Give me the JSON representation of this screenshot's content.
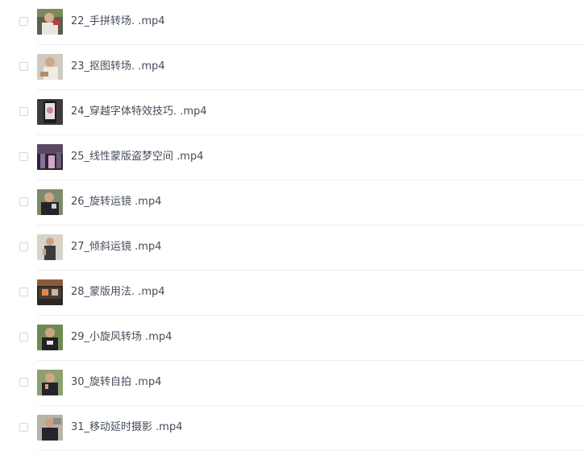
{
  "files": [
    {
      "name": "22_手拼转场. .mp4",
      "thumb_icon": "video-thumbnail-icon"
    },
    {
      "name": "23_抠图转场. .mp4",
      "thumb_icon": "video-thumbnail-icon"
    },
    {
      "name": "24_穿越字体特效技巧. .mp4",
      "thumb_icon": "video-thumbnail-icon"
    },
    {
      "name": "25_线性蒙版盗梦空间 .mp4",
      "thumb_icon": "video-thumbnail-icon"
    },
    {
      "name": "26_旋转运镜 .mp4",
      "thumb_icon": "video-thumbnail-icon"
    },
    {
      "name": "27_倾斜运镜 .mp4",
      "thumb_icon": "video-thumbnail-icon"
    },
    {
      "name": "28_蒙版用法. .mp4",
      "thumb_icon": "video-thumbnail-icon"
    },
    {
      "name": "29_小旋风转场 .mp4",
      "thumb_icon": "video-thumbnail-icon"
    },
    {
      "name": "30_旋转自拍 .mp4",
      "thumb_icon": "video-thumbnail-icon"
    },
    {
      "name": "31_移动延时摄影 .mp4",
      "thumb_icon": "video-thumbnail-icon"
    }
  ],
  "colors": {
    "text": "#454d5a",
    "divider": "#eeeff2",
    "checkbox_border": "#d3d6dc"
  }
}
